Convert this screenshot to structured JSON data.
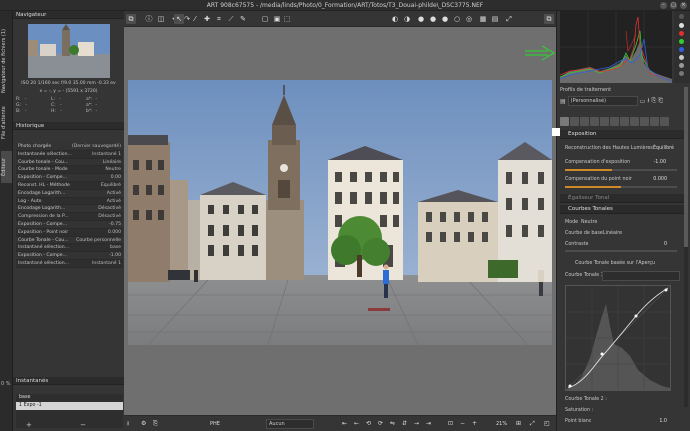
{
  "window": {
    "title": "ART 908c67575 - /media/linds/Photo/0_Formation/ART/Totos/T3_Douai-philde\\_DSC3775.NEF"
  },
  "vtabs": {
    "file_browser": "Navigateur de fichiers (1)",
    "queue": "File d'attente",
    "editor": "Éditeur",
    "zoom_status": "0 %"
  },
  "navigator": {
    "title": "Navigateur",
    "exposure": "ISO 20   1/160 sec   f/9.0   35.00 mm   -0.33 ev",
    "coords": "x = -, y = -   (5591 x 3720)",
    "rgb_labels": [
      [
        "R:",
        "-",
        "L:",
        "-",
        "a*:",
        "-"
      ],
      [
        "G:",
        "-",
        "C:",
        "-",
        "a*:",
        "-"
      ],
      [
        "B:",
        "-",
        "H:",
        "-",
        "b*:",
        "-"
      ]
    ]
  },
  "history": {
    "title": "Historique",
    "rows": [
      {
        "label": "Photo chargée",
        "value": "(Dernier sauvegardé)"
      },
      {
        "label": "Instantanée sélection...",
        "value": "Instantané 1"
      },
      {
        "label": "Courbe tonale - Cou...",
        "value": "Linéaire"
      },
      {
        "label": "Courbe tonale - Mode",
        "value": "Neutre"
      },
      {
        "label": "Exposition - Compe...",
        "value": "0.00"
      },
      {
        "label": "Reconst. HL - Méthode",
        "value": "Équilibré"
      },
      {
        "label": "Encodage Logarith...",
        "value": "Activé"
      },
      {
        "label": "Log - Auto",
        "value": "Activé"
      },
      {
        "label": "Encodage Logarith...",
        "value": "Désactivé"
      },
      {
        "label": "Compression de la P...",
        "value": "Désactivé"
      },
      {
        "label": "Exposition - Compe...",
        "value": "-0.75"
      },
      {
        "label": "Exposition - Point noir",
        "value": "0.000"
      },
      {
        "label": "Courbe Tonale - Cou...",
        "value": "Courbe personnelle"
      },
      {
        "label": "Instantané sélection...",
        "value": "base"
      },
      {
        "label": "Exposition - Compe...",
        "value": "-1.00"
      },
      {
        "label": "Instantané sélection...",
        "value": "Instantané 1"
      }
    ]
  },
  "snapshots": {
    "title": "Instantanés",
    "items": [
      "base",
      "1 Expo -1"
    ],
    "selected_index": 1,
    "add": "+",
    "remove": "−"
  },
  "bottombar": {
    "format": "PHE",
    "combo": "Aucun",
    "zoom": "21%"
  },
  "profile": {
    "title": "Profils de traitement",
    "selected": "(Personnalisé)"
  },
  "exposure": {
    "title": "Exposition",
    "hl_reconstruction_label": "Reconstruction des Hautes Lumières",
    "hl_reconstruction_value": "Équilibré",
    "comp_label": "Compensation d'exposition",
    "comp_value": "-1.00",
    "comp_fill": 0.42,
    "black_label": "Compensation du point noir",
    "black_value": "0.000",
    "black_fill": 0.5
  },
  "equalizer": {
    "title": "Égaliseur Tonal"
  },
  "tonecurve": {
    "title": "Courbes Tonales",
    "mode_label": "Mode",
    "mode_value": "Neutre",
    "base_label": "Courbe de base",
    "base_value": "Linéaire",
    "contrast_label": "Contraste",
    "contrast_value": "0",
    "apercu": "Courbe Tonale basée sur l'Aperçu",
    "curve1_label": "Courbe Tonale 1 :",
    "curve2_label": "Courbe Tonale 2 :",
    "saturation_label": "Saturation :",
    "white_label": "Point blanc",
    "white_value": "1.0"
  },
  "colors": {
    "accent": "#d08a2a",
    "histo_red": "#e03030",
    "histo_green": "#30d030",
    "histo_blue": "#3060e0",
    "arrow": "#33cc33"
  }
}
